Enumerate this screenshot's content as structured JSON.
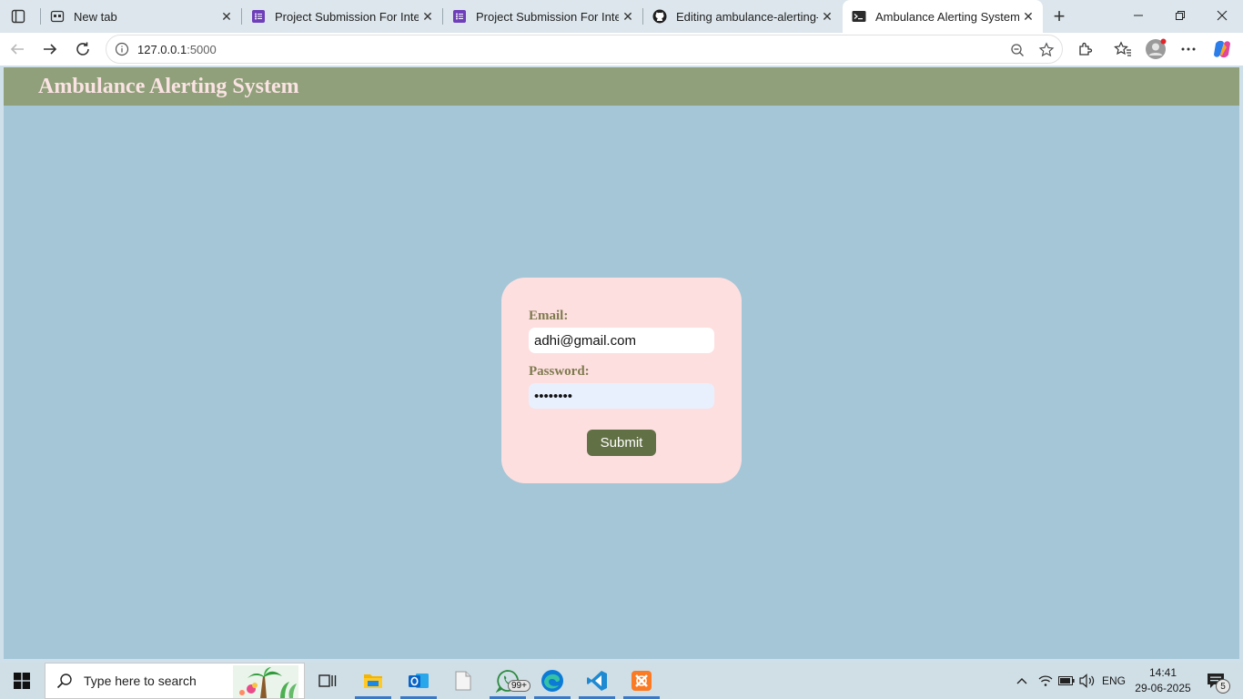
{
  "browser": {
    "tabs": [
      {
        "title": "New tab",
        "icon": "newtab-icon"
      },
      {
        "title": "Project Submission For Interns",
        "icon": "forms-icon"
      },
      {
        "title": "Project Submission For Interns",
        "icon": "forms-icon"
      },
      {
        "title": "Editing ambulance-alerting-system",
        "icon": "github-icon"
      },
      {
        "title": "Ambulance Alerting System",
        "icon": "terminal-icon"
      }
    ],
    "active_tab_index": 4,
    "address": {
      "host": "127.0.0.1",
      "port": ":5000"
    },
    "colors": {
      "tabbar": "#dce6ec",
      "active_tab": "#ffffff"
    }
  },
  "page": {
    "header_title": "Ambulance Alerting System",
    "form": {
      "email_label": "Email:",
      "email_value": "adhi@gmail.com",
      "password_label": "Password:",
      "password_value": "••••••••",
      "submit_label": "Submit"
    },
    "colors": {
      "background": "#a4c6d6",
      "header": "#8fa07a",
      "header_text": "#fbe3e3",
      "card": "#fddfe0",
      "label": "#7e7a4d",
      "button": "#627045"
    }
  },
  "taskbar": {
    "search_placeholder": "Type here to search",
    "apps": [
      {
        "name": "task-view-icon"
      },
      {
        "name": "file-explorer-icon"
      },
      {
        "name": "outlook-icon"
      },
      {
        "name": "notepad-icon"
      },
      {
        "name": "whatsapp-icon",
        "badge": "99+"
      },
      {
        "name": "edge-icon"
      },
      {
        "name": "vscode-icon"
      },
      {
        "name": "xampp-icon"
      }
    ],
    "tray": {
      "language": "ENG",
      "time": "14:41",
      "date": "29-06-2025",
      "notifications": "5"
    }
  }
}
